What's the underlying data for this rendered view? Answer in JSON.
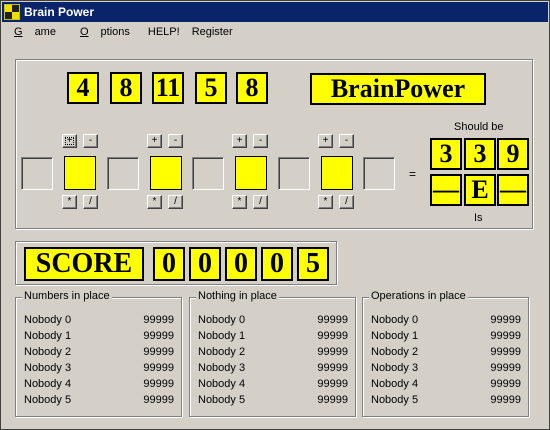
{
  "window": {
    "title": "Brain Power"
  },
  "menu": [
    "Game",
    "Options",
    "HELP!",
    "Register"
  ],
  "puzzle": {
    "numbers": [
      "4",
      "8",
      "11",
      "5",
      "8"
    ],
    "logo": "BrainPower",
    "operator_buttons_top": [
      [
        "+",
        "-"
      ],
      [
        "+",
        "-"
      ],
      [
        "+",
        "-"
      ],
      [
        "+",
        "-"
      ]
    ],
    "operator_buttons_bottom": [
      [
        "*",
        "/"
      ],
      [
        "*",
        "/"
      ],
      [
        "*",
        "/"
      ],
      [
        "*",
        "/"
      ]
    ],
    "equals": "=",
    "should_be_label": "Should be",
    "target": [
      "3",
      "3",
      "9"
    ],
    "result": [
      "—",
      "E",
      "—"
    ],
    "is_label": "Is"
  },
  "score": {
    "label": "SCORE",
    "digits": [
      "0",
      "0",
      "0",
      "0",
      "5"
    ]
  },
  "highscores": [
    {
      "title": "Numbers in place",
      "rows": [
        {
          "name": "Nobody 0",
          "value": "99999"
        },
        {
          "name": "Nobody 1",
          "value": "99999"
        },
        {
          "name": "Nobody 2",
          "value": "99999"
        },
        {
          "name": "Nobody 3",
          "value": "99999"
        },
        {
          "name": "Nobody 4",
          "value": "99999"
        },
        {
          "name": "Nobody 5",
          "value": "99999"
        }
      ]
    },
    {
      "title": "Nothing in place",
      "rows": [
        {
          "name": "Nobody 0",
          "value": "99999"
        },
        {
          "name": "Nobody 1",
          "value": "99999"
        },
        {
          "name": "Nobody 2",
          "value": "99999"
        },
        {
          "name": "Nobody 3",
          "value": "99999"
        },
        {
          "name": "Nobody 4",
          "value": "99999"
        },
        {
          "name": "Nobody 5",
          "value": "99999"
        }
      ]
    },
    {
      "title": "Operations in place",
      "rows": [
        {
          "name": "Nobody 0",
          "value": "99999"
        },
        {
          "name": "Nobody 1",
          "value": "99999"
        },
        {
          "name": "Nobody 2",
          "value": "99999"
        },
        {
          "name": "Nobody 3",
          "value": "99999"
        },
        {
          "name": "Nobody 4",
          "value": "99999"
        },
        {
          "name": "Nobody 5",
          "value": "99999"
        }
      ]
    }
  ],
  "colors": {
    "tile": "#ffff00",
    "titlebar": "#0a246a",
    "face": "#d4d0c8"
  },
  "icons": {
    "app": "brain-power-app-icon"
  }
}
